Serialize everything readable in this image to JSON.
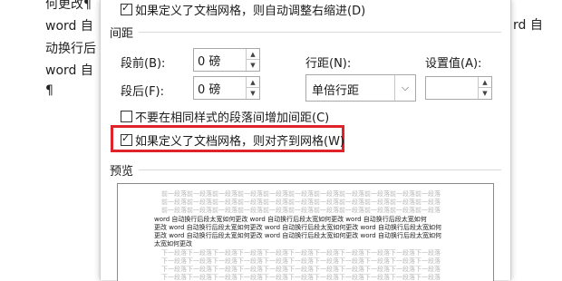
{
  "document": {
    "lines": [
      "何更改¶",
      "word 自",
      "动换行后",
      "word 自",
      "¶"
    ],
    "right_fragment": "rd 自"
  },
  "dialog": {
    "top_checkbox": {
      "label": "如果定义了文档网格，则自动调整右缩进(D)",
      "checked": true
    },
    "spacing_section": "间距",
    "before": {
      "label": "段前(B):",
      "value": "0 磅"
    },
    "after": {
      "label": "段后(F):",
      "value": "0 磅"
    },
    "line_spacing": {
      "label": "行距(N):",
      "value": "单倍行距"
    },
    "setting": {
      "label": "设置值(A):",
      "value": ""
    },
    "no_space_same_style": {
      "label": "不要在相同样式的段落间增加间距(C)",
      "checked": false
    },
    "snap_to_grid": {
      "label": "如果定义了文档网格，则对齐到网格(W)",
      "checked": true
    },
    "preview_section": "预览",
    "preview": {
      "prev_text": "前一段落前一段落前一段落前一段落前一段落前一段落前一段落前一段落前一段落前一段落前一段落",
      "body_text": [
        "word 自动换行后段太宽如何更改 word 自动换行后段太宽如何更改 word 自动换行后段太宽如何",
        "更改 word 自动换行后段太宽如何更改 word 自动换行后段太宽如何更改 word 自动换行后段太宽如何",
        "更改 word 自动换行后段太宽如何更改 word 自动换行后段太宽如何更改 word 自动换行后段太宽如何",
        "太宽如何更改"
      ],
      "next_text": "下一段落下一段落下一段落下一段落下一段落下一段落下一段落下一段落下一段落下一段落下一段落"
    }
  }
}
